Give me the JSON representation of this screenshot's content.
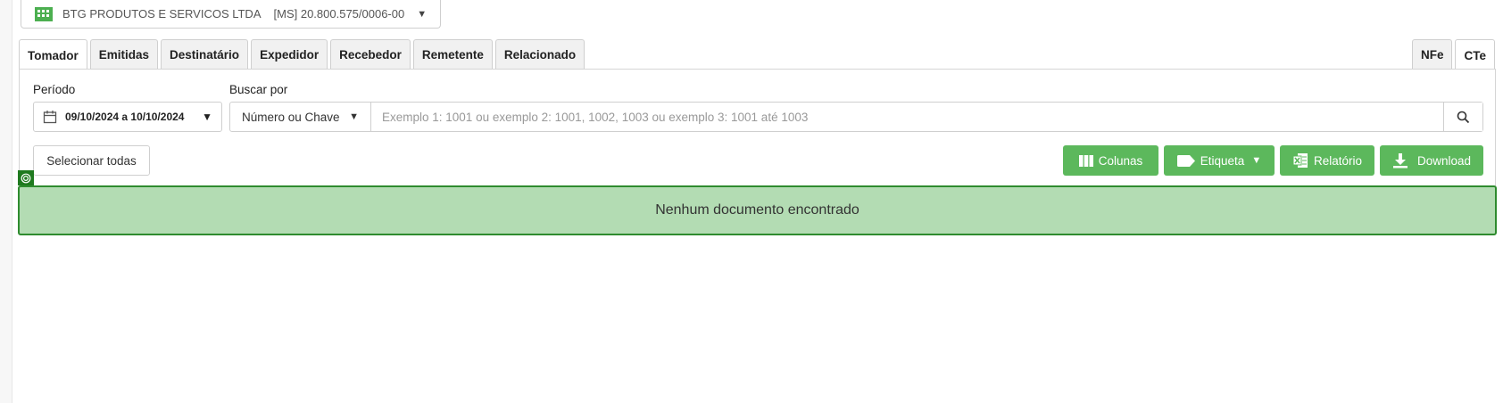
{
  "company": {
    "name": "BTG PRODUTOS E SERVICOS LTDA",
    "cnpj": "[MS] 20.800.575/0006-00",
    "icon": "building-icon"
  },
  "tabs": [
    {
      "label": "Tomador",
      "active": true
    },
    {
      "label": "Emitidas",
      "active": false
    },
    {
      "label": "Destinatário",
      "active": false
    },
    {
      "label": "Expedidor",
      "active": false
    },
    {
      "label": "Recebedor",
      "active": false
    },
    {
      "label": "Remetente",
      "active": false
    },
    {
      "label": "Relacionado",
      "active": false
    }
  ],
  "doc_tabs": [
    {
      "label": "NFe",
      "active": false
    },
    {
      "label": "CTe",
      "active": true
    }
  ],
  "filters": {
    "periodo_label": "Período",
    "periodo_value": "09/10/2024 a 10/10/2024",
    "buscar_label": "Buscar por",
    "buscar_type": "Número ou Chave",
    "search_placeholder": "Exemplo 1: 1001 ou exemplo 2: 1001, 1002, 1003 ou exemplo 3: 1001 até 1003",
    "search_value": ""
  },
  "actions": {
    "select_all": "Selecionar todas",
    "colunas": "Colunas",
    "etiqueta": "Etiqueta",
    "relatorio": "Relatório",
    "download": "Download"
  },
  "empty_message": "Nenhum documento encontrado",
  "colors": {
    "accent_green": "#5cb85c",
    "alert_bg": "#b3dcb3",
    "alert_border": "#2e8b2e"
  }
}
